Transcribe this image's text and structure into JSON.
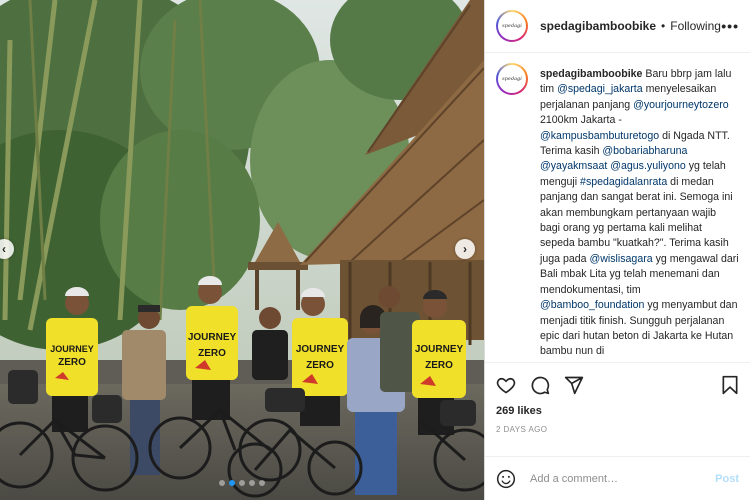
{
  "header": {
    "username": "spedagibamboobike",
    "bullet": "•",
    "follow_state": "Following",
    "more_icon": "more-options-icon",
    "avatar_text": "spedagi"
  },
  "caption": {
    "username": "spedagibamboobike",
    "t1": " Baru bbrp jam lalu tim ",
    "m1": "@spedagi_jakarta",
    "t2": " menyelesaikan perjalanan panjang ",
    "m2": "@yourjourneytozero",
    "t3": " 2100km Jakarta - ",
    "m3": "@kampusbambuturetogo",
    "t4": " di Ngada NTT. Terima kasih ",
    "m4": "@bobariabharuna",
    "t5": " ",
    "m5": "@yayakmsaat",
    "t6": " ",
    "m6": "@agus.yuliyono",
    "t7": " yg telah menguji ",
    "m7": "#spedagidalanrata",
    "t8": " di medan panjang dan sangat berat ini. Semoga ini akan membungkam pertanyaan wajib bagi orang yg pertama kali melihat sepeda bambu \"kuatkah?\". Terima kasih juga pada ",
    "m8": "@wislisagara",
    "t9": " yg mengawal dari Bali mbak Lita yg telah menemani dan mendokumentasi, tim ",
    "m9": "@bamboo_foundation",
    "t10": " yg menyambut dan menjadi titik finish. Sungguh perjalanan epic dari hutan beton di Jakarta ke Hutan bambu nun di"
  },
  "photo": {
    "shirt_text": [
      "JOURNEY",
      "ZERO"
    ],
    "nav_prev_icon": "chevron-left-icon",
    "nav_next_icon": "chevron-right-icon",
    "prev_glyph": "‹",
    "next_glyph": "›",
    "carousel_count": 5,
    "carousel_active": 1
  },
  "actions": {
    "icons": [
      "heart-icon",
      "comment-icon",
      "share-icon",
      "bookmark-icon"
    ],
    "likes": "269 likes",
    "timestamp": "2 DAYS AGO"
  },
  "comment": {
    "placeholder": "Add a comment…",
    "post_label": "Post",
    "emoji_icon": "emoji-icon"
  },
  "colors": {
    "link": "#00376b",
    "shirt": "#f0e02a",
    "carousel_active": "#2196f3",
    "post_disabled": "#b2dffc"
  }
}
